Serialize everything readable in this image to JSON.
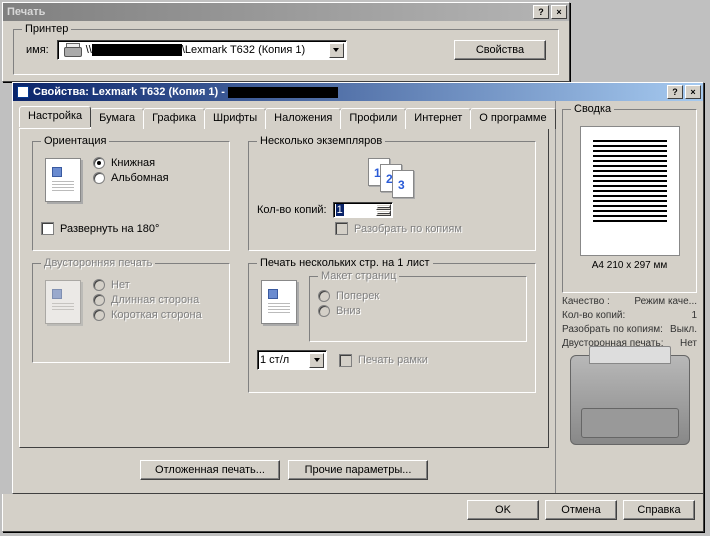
{
  "print_dialog": {
    "title": "Печать",
    "printer_group": "Принтер",
    "name_label": "имя:",
    "printer_name_suffix": "\\Lexmark T632 (Копия 1)",
    "properties_btn": "Свойства"
  },
  "props_dialog": {
    "title": "Свойства: Lexmark T632 (Копия 1) -",
    "tabs": [
      "Настройка",
      "Бумага",
      "Графика",
      "Шрифты",
      "Наложения",
      "Профили",
      "Интернет",
      "О программе"
    ],
    "active_tab": 0,
    "orientation": {
      "legend": "Ориентация",
      "portrait": "Книжная",
      "landscape": "Альбомная",
      "rotate": "Развернуть на 180°"
    },
    "copies": {
      "legend": "Несколько экземпляров",
      "count_label": "Кол-во копий:",
      "count_value": "1",
      "collate": "Разобрать по копиям"
    },
    "duplex": {
      "legend": "Двусторонняя печать",
      "none": "Нет",
      "long": "Длинная сторона",
      "short": "Короткая сторона"
    },
    "nup": {
      "legend": "Печать нескольких стр. на 1 лист",
      "layout_legend": "Макет страниц",
      "across": "Поперек",
      "down": "Вниз",
      "per_sheet": "1 ст/л",
      "border": "Печать рамки"
    },
    "delayed_btn": "Отложенная печать...",
    "other_btn": "Прочие параметры...",
    "ok": "OK",
    "cancel": "Отмена",
    "help": "Справка"
  },
  "summary": {
    "legend": "Сводка",
    "paper": "A4 210 x 297 мм",
    "rows": {
      "quality_k": "Качество :",
      "quality_v": "Режим каче...",
      "copies_k": "Кол-во копий:",
      "copies_v": "1",
      "collate_k": "Разобрать по копиям:",
      "collate_v": "Выкл.",
      "duplex_k": "Двусторонная печать:",
      "duplex_v": "Нет"
    }
  }
}
